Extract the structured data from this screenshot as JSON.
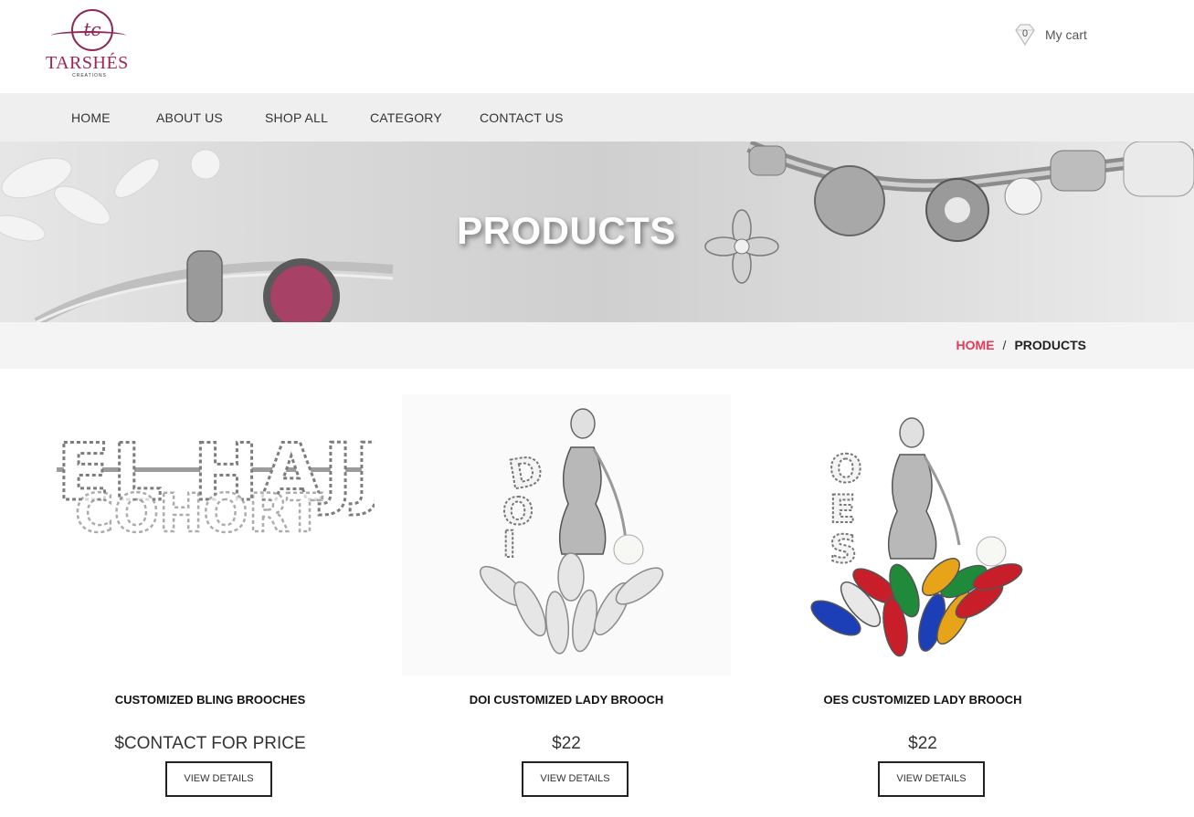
{
  "logo": {
    "monogram": "tc",
    "name": "TARSHÉS",
    "tagline": "CREATIONS"
  },
  "cart": {
    "count": "0",
    "label": "My cart"
  },
  "nav": [
    {
      "label": "HOME"
    },
    {
      "label": "ABOUT US"
    },
    {
      "label": "SHOP ALL"
    },
    {
      "label": "CATEGORY"
    },
    {
      "label": "CONTACT US"
    }
  ],
  "banner": {
    "title": "PRODUCTS"
  },
  "breadcrumb": {
    "home": "HOME",
    "separator": "/",
    "current": "PRODUCTS"
  },
  "products": [
    {
      "name": "CUSTOMIZED BLING BROOCHES",
      "price": "$CONTACT FOR PRICE",
      "button": "VIEW DETAILS",
      "image_text": "EL HAJJ"
    },
    {
      "name": "DOI CUSTOMIZED LADY BROOCH",
      "price": "$22",
      "button": "VIEW DETAILS",
      "image_text": "DOI"
    },
    {
      "name": "OES CUSTOMIZED LADY BROOCH",
      "price": "$22",
      "button": "VIEW DETAILS",
      "image_text": "OES"
    }
  ],
  "colors": {
    "accent": "#e23a5a",
    "brand": "#a0264f",
    "nav_bg": "#efefef"
  }
}
